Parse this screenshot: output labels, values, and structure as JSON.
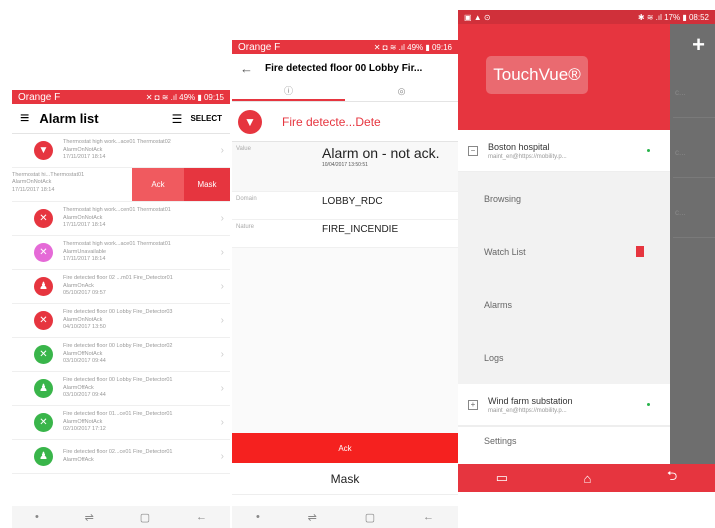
{
  "phone1": {
    "status": {
      "carrier": "Orange F",
      "icons": "✕ ◘ ≋ .ıl 49% ▮ 09:15"
    },
    "title": "Alarm list",
    "select_label": "SELECT",
    "swipe_row": {
      "lines": [
        "Thermostat hi...Thermostat01",
        "AlarmOnNotAck",
        "17/11/2017 18:14"
      ],
      "ack": "Ack",
      "mask": "Mask"
    },
    "rows": [
      {
        "color": "#e6353f",
        "icon": "▼",
        "l1": "Thermostat high work...ace01 Thermostat02",
        "l2": "AlarmOnNotAck",
        "l3": "17/11/2017 18:14"
      },
      {
        "color": "#e6353f",
        "icon": "✕",
        "l1": "Thermostat high work...cen01 Thermostat01",
        "l2": "AlarmOnNotAck",
        "l3": "17/11/2017 18:14"
      },
      {
        "color": "#e56ad7",
        "icon": "✕",
        "l1": "Thermostat high work...ace01 Thermostat01",
        "l2": "AlarmUnavailable",
        "l3": "17/11/2017 18:14"
      },
      {
        "color": "#e6353f",
        "icon": "♟",
        "l1": "Fire detected floor 02 ...m01 Fire_Detector01",
        "l2": "AlarmOnAck",
        "l3": "05/10/2017 09:57"
      },
      {
        "color": "#e6353f",
        "icon": "✕",
        "l1": "Fire detected floor 00 Lobby Fire_Detector03",
        "l2": "AlarmOnNotAck",
        "l3": "04/10/2017 13:50"
      },
      {
        "color": "#39b54a",
        "icon": "✕",
        "l1": "Fire detected floor 00 Lobby Fire_Detector02",
        "l2": "AlarmOffNotAck",
        "l3": "03/10/2017 09:44"
      },
      {
        "color": "#39b54a",
        "icon": "♟",
        "l1": "Fire detected floor 00 Lobby Fire_Detector01",
        "l2": "AlarmOffAck",
        "l3": "03/10/2017 09:44"
      },
      {
        "color": "#39b54a",
        "icon": "✕",
        "l1": "Fire detected floor 01...ce01 Fire_Detector01",
        "l2": "AlarmOffNotAck",
        "l3": "02/10/2017 17:12"
      },
      {
        "color": "#39b54a",
        "icon": "♟",
        "l1": "Fire detected floor 02...ce01 Fire_Detector01",
        "l2": "AlarmOffAck",
        "l3": ""
      }
    ],
    "nav": [
      "•",
      "⇌",
      "▢",
      "←"
    ]
  },
  "phone2": {
    "status": {
      "carrier": "Orange F",
      "icons": "✕ ◘ ≋ .ıl 49% ▮ 09:16"
    },
    "title": "Fire detected floor 00 Lobby Fir...",
    "tabs": [
      "ⓘ",
      "◎"
    ],
    "header": "Fire detecte...Dete",
    "props": {
      "value_key": "Value",
      "value": "Alarm on - not ack.",
      "value_date": "10/04/2017 13:50:51",
      "domain_key": "Domain",
      "domain": "LOBBY_RDC",
      "nature_key": "Nature",
      "nature": "FIRE_INCENDIE"
    },
    "ack": "Ack",
    "mask": "Mask",
    "nav": [
      "•",
      "⇌",
      "▢",
      "←"
    ]
  },
  "phone3": {
    "status": {
      "left": "▣ ▲ ⊙",
      "right": "✱ ≋ .ıl 17% ▮ 08:52"
    },
    "logo": "TouchVue®",
    "sites": [
      {
        "box": "−",
        "name": "Boston hospital",
        "user": "maint_en@https://mobility.p..."
      },
      {
        "box": "+",
        "name": "Wind farm substation",
        "user": "maint_en@https://mobility.p..."
      }
    ],
    "menu": [
      "Browsing",
      "Watch List",
      "Alarms",
      "Logs"
    ],
    "settings": "Settings",
    "plus": "+",
    "bg_rows": [
      "c...",
      "c...",
      "c..."
    ],
    "nav": [
      "▭",
      "⌂",
      "⮌"
    ]
  }
}
